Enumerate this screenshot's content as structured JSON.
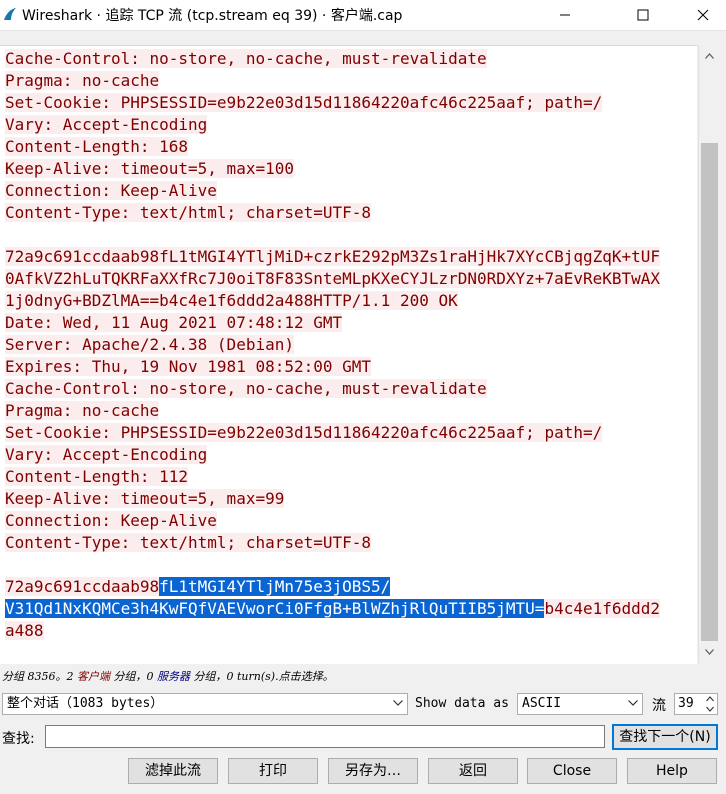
{
  "window": {
    "title": "Wireshark · 追踪 TCP 流 (tcp.stream eq 39) · 客户端.cap"
  },
  "stream": {
    "lines": [
      "Cache-Control: no-store, no-cache, must-revalidate",
      "Pragma: no-cache",
      "Set-Cookie: PHPSESSID=e9b22e03d15d11864220afc46c225aaf; path=/",
      "Vary: Accept-Encoding",
      "Content-Length: 168",
      "Keep-Alive: timeout=5, max=100",
      "Connection: Keep-Alive",
      "Content-Type: text/html; charset=UTF-8",
      "",
      "72a9c691ccdaab98fL1tMGI4YTljMiD+czrkE292pM3Zs1raHjHk7XYcCBjqgZqK+tUF",
      "0AfkVZ2hLuTQKRFaXXfRc7J0oiT8F83SnteMLpKXeCYJLzrDN0RDXYz+7aEvReKBTwAX",
      "1j0dnyG+BDZlMA==b4c4e1f6ddd2a488HTTP/1.1 200 OK",
      "Date: Wed, 11 Aug 2021 07:48:12 GMT",
      "Server: Apache/2.4.38 (Debian)",
      "Expires: Thu, 19 Nov 1981 08:52:00 GMT",
      "Cache-Control: no-store, no-cache, must-revalidate",
      "Pragma: no-cache",
      "Set-Cookie: PHPSESSID=e9b22e03d15d11864220afc46c225aaf; path=/",
      "Vary: Accept-Encoding",
      "Content-Length: 112",
      "Keep-Alive: timeout=5, max=99",
      "Connection: Keep-Alive",
      "Content-Type: text/html; charset=UTF-8",
      ""
    ],
    "last_line1_pre": "72a9c691ccdaab98",
    "last_line1_sel": "fL1tMGI4YTljMn75e3jOBS5/",
    "last_line2_sel": "V31Qd1NxKQMCe3h4KwFQfVAEVworCi0FfgB+BlWZhjRlQuTIIB5jMTU=",
    "last_line2_post": "b4c4e1f6ddd2",
    "last_line3": "a488"
  },
  "status": {
    "part1": "分组 8356。2 ",
    "client_label": "客户端",
    "part2": " 分组，0 ",
    "server_label": "服务器",
    "part3": " 分组，0 turn(s).点击选择。"
  },
  "controls": {
    "conversation_select": "整个对话（1083 bytes）",
    "show_data_as_label": "Show data as",
    "show_data_as_value": "ASCII",
    "stream_label": "流",
    "stream_value": "39",
    "find_label": "查找:",
    "find_value": "",
    "find_next_button": "查找下一个(N)"
  },
  "buttons": {
    "filter_out": "滤掉此流",
    "print": "打印",
    "save_as": "另存为…",
    "back": "返回",
    "close": "Close",
    "help": "Help"
  }
}
